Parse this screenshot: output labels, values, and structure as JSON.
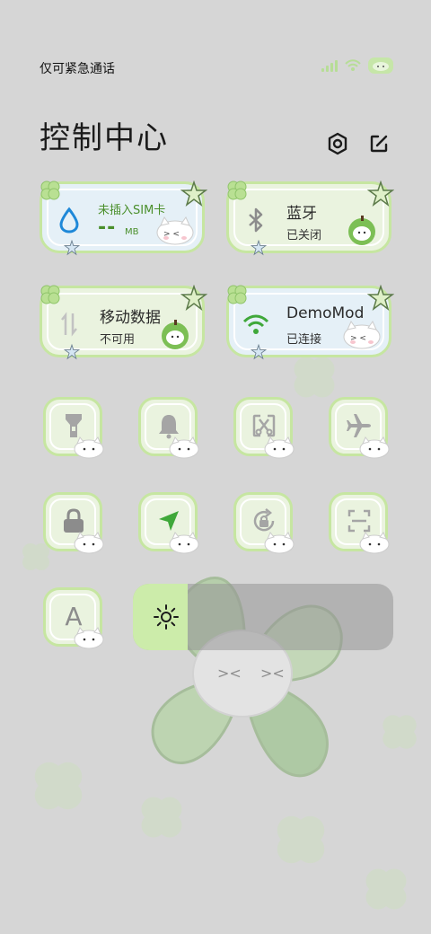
{
  "status_bar": {
    "carrier_text": "仅可紧急通话",
    "icons": [
      "signal-icon",
      "wifi-icon",
      "battery-icon"
    ]
  },
  "header": {
    "title": "控制中心",
    "settings_icon": "gear-icon",
    "edit_icon": "edit-icon"
  },
  "tiles": {
    "mobile_data_usage": {
      "title": "未插入SIM卡",
      "value": "--",
      "unit": "MB",
      "icon": "water-drop-icon"
    },
    "bluetooth": {
      "title": "蓝牙",
      "status": "已关闭",
      "icon": "bluetooth-icon"
    },
    "mobile_data": {
      "title": "移动数据",
      "status": "不可用",
      "icon": "data-arrows-icon"
    },
    "wifi": {
      "title": "DemoMod",
      "status": "已连接",
      "icon": "wifi-icon"
    }
  },
  "toggles": [
    {
      "name": "flashlight",
      "icon": "flashlight-icon"
    },
    {
      "name": "ringer",
      "icon": "bell-icon"
    },
    {
      "name": "screenshot",
      "icon": "screenshot-icon"
    },
    {
      "name": "airplane",
      "icon": "airplane-icon"
    },
    {
      "name": "lock-screen",
      "icon": "lock-icon"
    },
    {
      "name": "location",
      "icon": "location-icon"
    },
    {
      "name": "rotation-lock",
      "icon": "rotation-lock-icon"
    },
    {
      "name": "scanner",
      "icon": "scan-icon"
    },
    {
      "name": "font-size",
      "icon": "font-icon",
      "label": "A"
    }
  ],
  "brightness": {
    "level_fraction": 0.21,
    "icon": "sun-icon"
  },
  "colors": {
    "tile_border": "#c6e6a1",
    "tile_bg": "#eaf3df",
    "tile_bg_blue": "#e5f0f7",
    "accent_green": "#4a8f2b",
    "brightness_fill": "#ccecaa"
  }
}
